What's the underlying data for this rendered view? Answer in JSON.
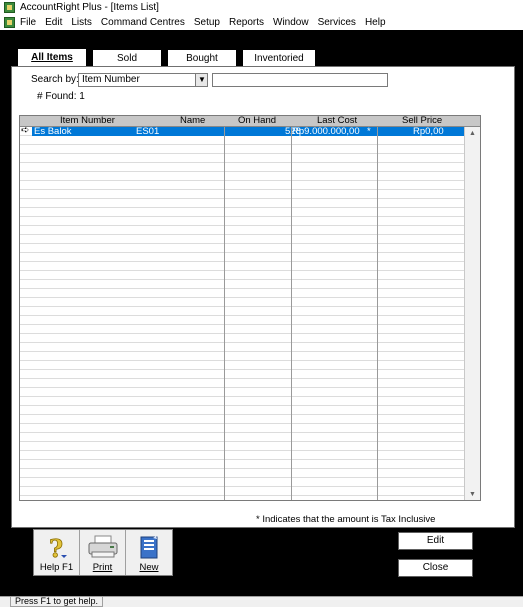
{
  "window": {
    "title": "AccountRight Plus - [Items List]"
  },
  "menu": [
    "File",
    "Edit",
    "Lists",
    "Command Centres",
    "Setup",
    "Reports",
    "Window",
    "Services",
    "Help"
  ],
  "tabs": [
    "All Items",
    "Sold",
    "Bought",
    "Inventoried"
  ],
  "search": {
    "label": "Search by:",
    "field": "Item Number",
    "text": ""
  },
  "found": {
    "label": "# Found:",
    "count": "1"
  },
  "grid": {
    "columns": [
      "Item Number",
      "Name",
      "On Hand",
      "Last Cost",
      "Sell Price"
    ],
    "rows": [
      {
        "item_number": "Es Balok",
        "name": "ES01",
        "on_hand": "528",
        "last_cost": "Rp9.000.000,00",
        "tax_flag": "*",
        "sell_price": "Rp0,00"
      }
    ]
  },
  "tax_note": "* Indicates that the amount is Tax Inclusive",
  "toolbar": {
    "help": "Help F1",
    "print": "Print",
    "new": "New"
  },
  "buttons": {
    "edit": "Edit",
    "close": "Close"
  },
  "status": "Press F1 to get help."
}
